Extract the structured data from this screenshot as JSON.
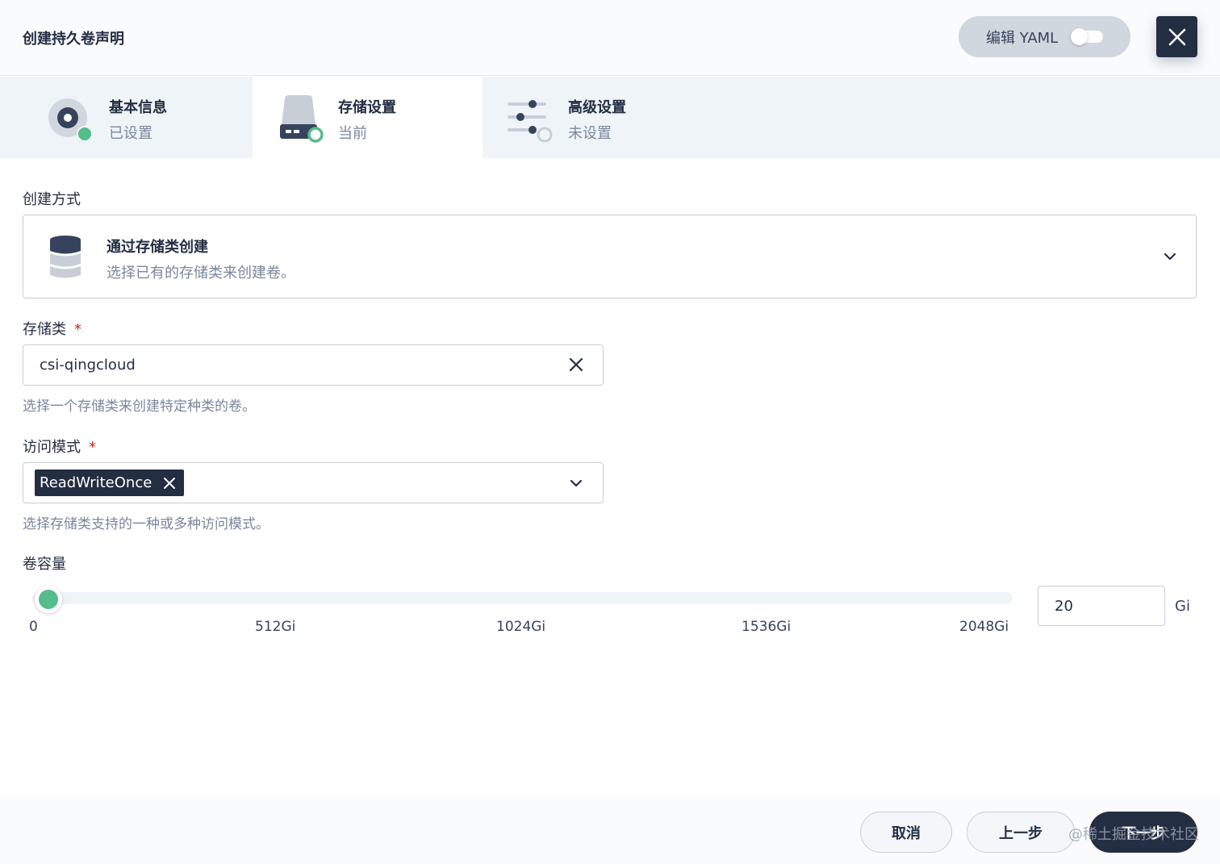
{
  "header": {
    "title": "创建持久卷声明",
    "yaml_button_label": "编辑 YAML"
  },
  "steps": [
    {
      "title": "基本信息",
      "status": "已设置"
    },
    {
      "title": "存储设置",
      "status": "当前"
    },
    {
      "title": "高级设置",
      "status": "未设置"
    }
  ],
  "create_method": {
    "label": "创建方式",
    "title": "通过存储类创建",
    "description": "选择已有的存储类来创建卷。"
  },
  "storage_class": {
    "label": "存储类",
    "required_mark": "*",
    "value": "csi-qingcloud",
    "hint": "选择一个存储类来创建特定种类的卷。"
  },
  "access_mode": {
    "label": "访问模式",
    "required_mark": "*",
    "selected_tag": "ReadWriteOnce",
    "hint": "选择存储类支持的一种或多种访问模式。"
  },
  "capacity": {
    "label": "卷容量",
    "ticks": [
      "0",
      "512Gi",
      "1024Gi",
      "1536Gi",
      "2048Gi"
    ],
    "value": "20",
    "unit": "Gi",
    "slider_max": 2048
  },
  "footer": {
    "cancel_label": "取消",
    "prev_label": "上一步",
    "next_label": "下一步",
    "watermark": "@稀土掘金技术社区"
  },
  "colors": {
    "primary": "#242e42",
    "success": "#55bc8a",
    "danger": "#ca2621",
    "muted": "#79879c"
  }
}
